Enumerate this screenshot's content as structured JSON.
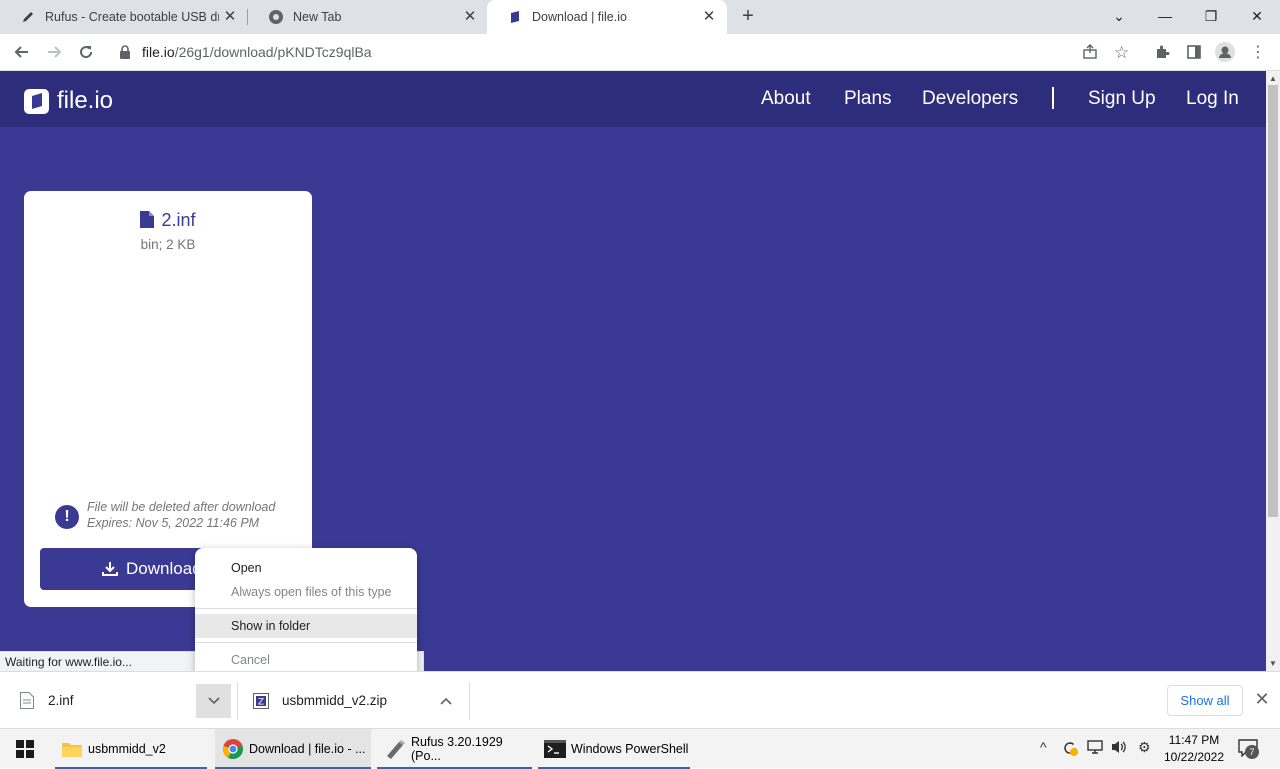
{
  "browser": {
    "tabs": [
      {
        "title": "Rufus - Create bootable USB drive",
        "icon": "pen-icon"
      },
      {
        "title": "New Tab",
        "icon": "chrome-icon"
      },
      {
        "title": "Download | file.io",
        "icon": "fileio-icon"
      }
    ],
    "new_tab": "+",
    "url_host": "file.io",
    "url_path": "/26g1/download/pKNDTcz9qlBa"
  },
  "site": {
    "logo_text": "file.io",
    "nav": [
      "About",
      "Plans",
      "Developers",
      "Sign Up",
      "Log In"
    ],
    "file_name": "2.inf",
    "file_meta": "bin; 2 KB",
    "warning_line1": "File will be deleted after download",
    "warning_line2": "Expires: Nov 5, 2022 11:46 PM",
    "download_label": "Download"
  },
  "status_text": "Waiting for www.file.io...",
  "context_menu": {
    "items": [
      "Open",
      "Always open files of this type",
      "Show in folder",
      "Cancel"
    ]
  },
  "download_shelf": {
    "items": [
      {
        "name": "2.inf"
      },
      {
        "name": "usbmmidd_v2.zip"
      }
    ],
    "show_all": "Show all"
  },
  "taskbar": {
    "apps": [
      {
        "label": "usbmmidd_v2"
      },
      {
        "label": "Download | file.io - ..."
      },
      {
        "label": "Rufus 3.20.1929 (Po..."
      },
      {
        "label": "Windows PowerShell"
      }
    ],
    "time": "11:47 PM",
    "date": "10/22/2022",
    "notifications": "7"
  }
}
